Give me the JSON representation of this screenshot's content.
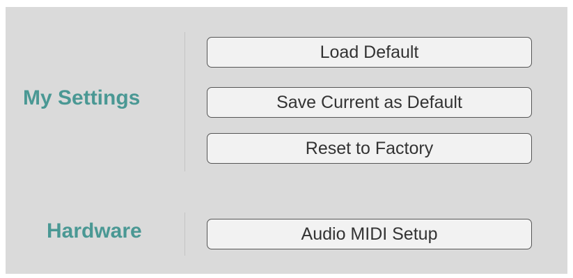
{
  "my_settings": {
    "label": "My Settings",
    "buttons": {
      "load_default": "Load Default",
      "save_current": "Save Current as Default",
      "reset_factory": "Reset to Factory"
    }
  },
  "hardware": {
    "label": "Hardware",
    "buttons": {
      "audio_midi_setup": "Audio MIDI Setup"
    }
  },
  "colors": {
    "accent": "#4a9894",
    "panel_background": "#dadada",
    "button_background": "#f2f2f2",
    "button_border": "#555555"
  }
}
